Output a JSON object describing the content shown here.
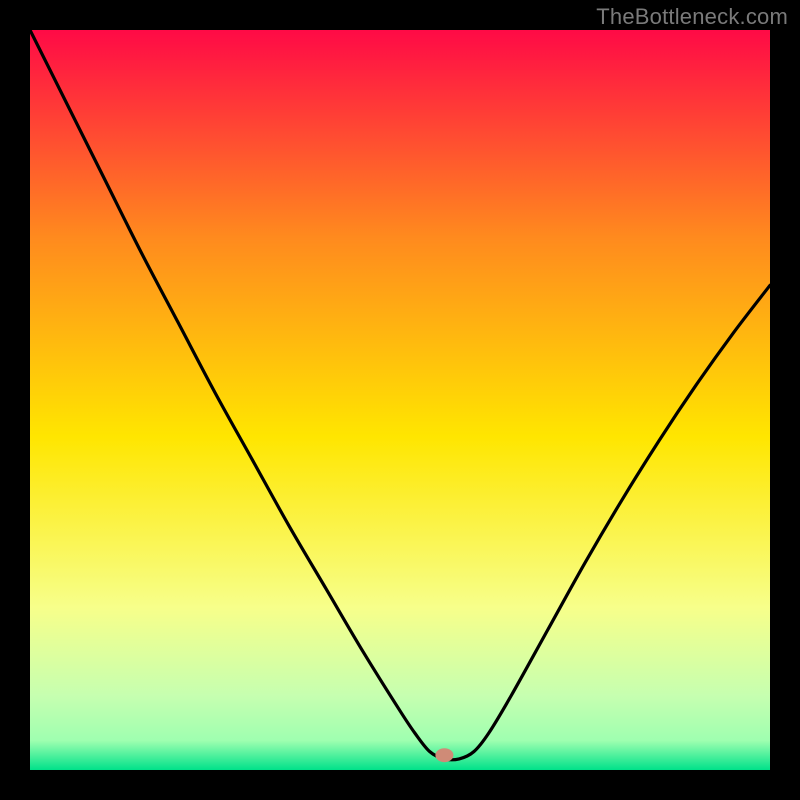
{
  "attribution": "TheBottleneck.com",
  "chart_data": {
    "type": "line",
    "title": "",
    "xlabel": "",
    "ylabel": "",
    "xlim": [
      0,
      100
    ],
    "ylim": [
      0,
      100
    ],
    "background_gradient": {
      "top": "#ff0a46",
      "upper_mid": "#ff8a1e",
      "mid": "#ffe600",
      "lower_mid": "#f7ff8a",
      "near_bottom": "#c6ffb0",
      "bottom": "#00e28a"
    },
    "marker": {
      "x": 56,
      "y": 2,
      "color": "#cf8b77"
    },
    "series": [
      {
        "name": "curve",
        "x": [
          0,
          5,
          10,
          15,
          20,
          25,
          30,
          35,
          40,
          45,
          50,
          52,
          54,
          56,
          58,
          60,
          62,
          65,
          70,
          75,
          80,
          85,
          90,
          95,
          100
        ],
        "y": [
          100,
          90,
          80,
          70,
          60.5,
          51,
          42,
          33,
          24.5,
          16,
          8,
          5,
          2.5,
          1.5,
          1.5,
          2.5,
          5,
          10,
          19,
          28,
          36.5,
          44.5,
          52,
          59,
          65.5
        ]
      }
    ]
  }
}
